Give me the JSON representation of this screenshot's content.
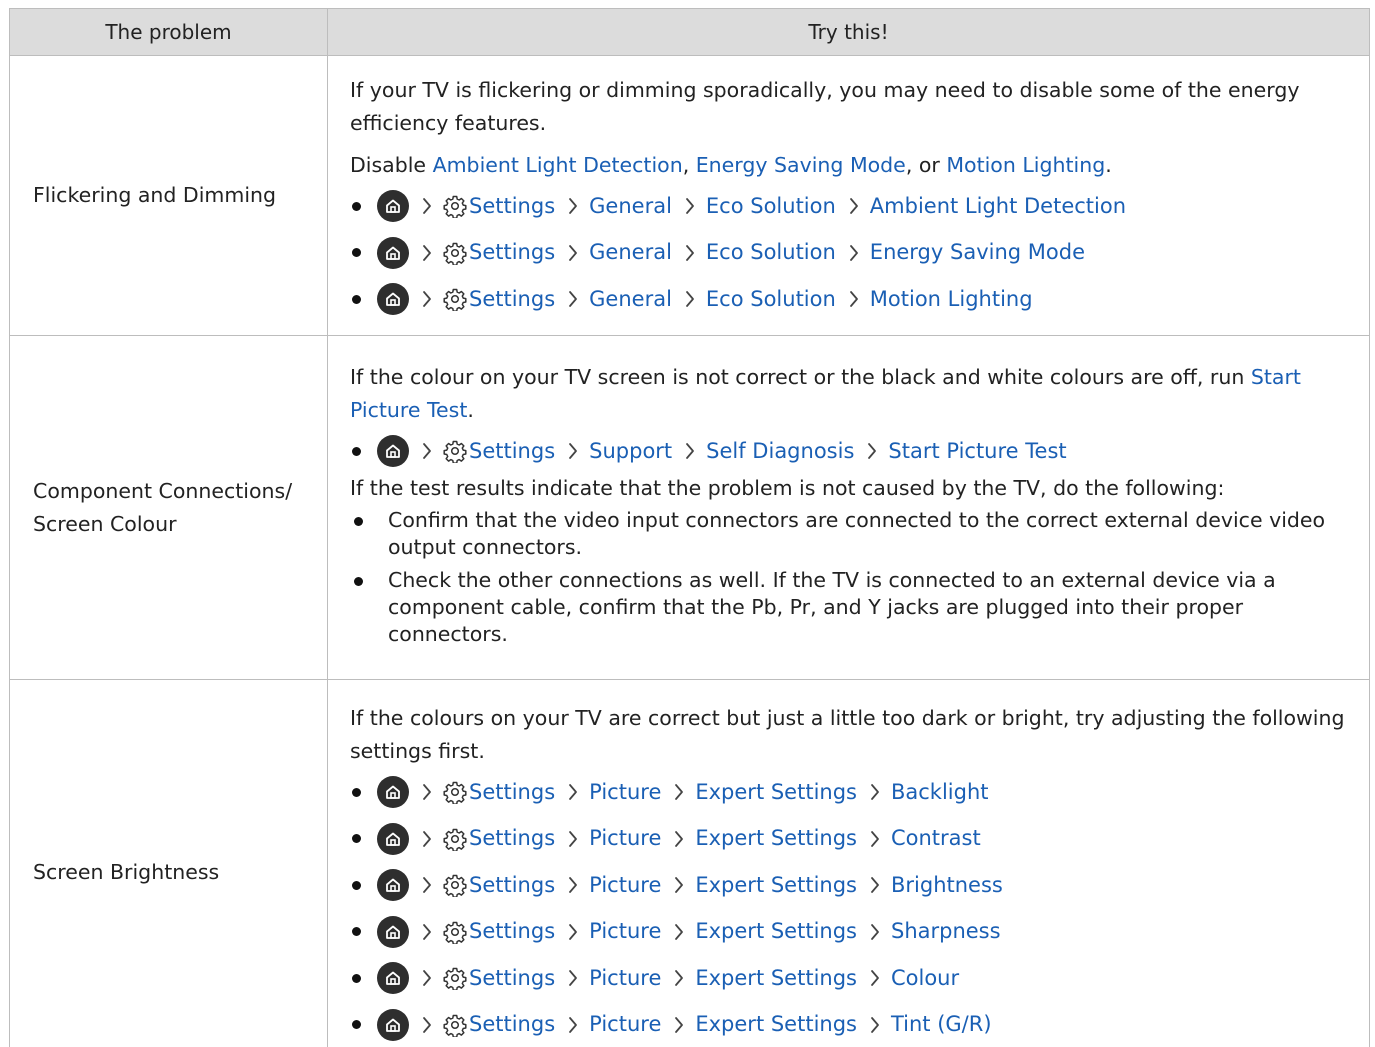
{
  "header": {
    "col1": "The problem",
    "col2": "Try this!"
  },
  "rows": [
    {
      "problem": "Flickering and Dimming",
      "intro": "If your TV is flickering or dimming sporadically, you may need to disable some of the energy efficiency features.",
      "disable_prefix": "Disable ",
      "disable_link1": "Ambient Light Detection",
      "disable_sep1": ", ",
      "disable_link2": "Energy Saving Mode",
      "disable_sep2": ", or ",
      "disable_link3": "Motion Lighting",
      "disable_suffix": ".",
      "paths": [
        [
          "Settings",
          "General",
          "Eco Solution",
          "Ambient Light Detection"
        ],
        [
          "Settings",
          "General",
          "Eco Solution",
          "Energy Saving Mode"
        ],
        [
          "Settings",
          "General",
          "Eco Solution",
          "Motion Lighting"
        ]
      ]
    },
    {
      "problem_line1": "Component Connections/",
      "problem_line2": "Screen Colour",
      "intro": "If the colour on your TV screen is not correct or the black and white colours are off, run ",
      "intro_link": "Start Picture Test",
      "intro_suffix": ".",
      "paths": [
        [
          "Settings",
          "Support",
          "Self Diagnosis",
          "Start Picture Test"
        ]
      ],
      "followup": "If the test results indicate that the problem is not caused by the TV, do the following:",
      "bullets": [
        "Confirm that the video input connectors are connected to the correct external device video output connectors.",
        "Check the other connections as well. If the TV is connected to an external device via a component cable, confirm that the Pb, Pr, and Y jacks are plugged into their proper connectors."
      ]
    },
    {
      "problem": "Screen Brightness",
      "intro": "If the colours on your TV are correct but just a little too dark or bright, try adjusting the following settings first.",
      "paths": [
        [
          "Settings",
          "Picture",
          "Expert Settings",
          "Backlight"
        ],
        [
          "Settings",
          "Picture",
          "Expert Settings",
          "Contrast"
        ],
        [
          "Settings",
          "Picture",
          "Expert Settings",
          "Brightness"
        ],
        [
          "Settings",
          "Picture",
          "Expert Settings",
          "Sharpness"
        ],
        [
          "Settings",
          "Picture",
          "Expert Settings",
          "Colour"
        ],
        [
          "Settings",
          "Picture",
          "Expert Settings",
          "Tint (G/R)"
        ]
      ]
    }
  ],
  "icons": {
    "home": "home-icon",
    "settings": "gear-icon",
    "separator": "chevron-right-icon"
  },
  "colors": {
    "link": "#1a5fb4",
    "header_bg": "#dcdcdc",
    "border": "#bdbdbd"
  }
}
